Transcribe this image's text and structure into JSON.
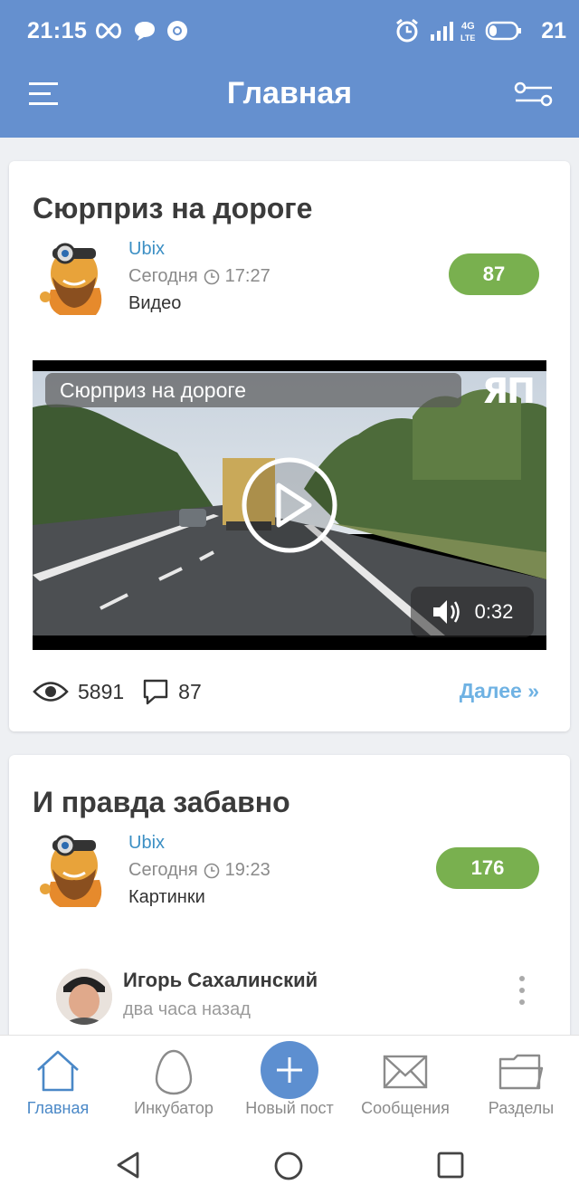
{
  "status_bar": {
    "time": "21:15",
    "battery": "21",
    "icons": [
      "infinity-icon",
      "chat-bubble-icon",
      "chrome-icon",
      "alarm-icon",
      "signal-icon",
      "4g-lte-icon",
      "battery-icon"
    ]
  },
  "header": {
    "title": "Главная",
    "menu_icon": "hamburger-menu-icon",
    "filter_icon": "filter-settings-icon"
  },
  "posts": [
    {
      "title": "Сюрприз на дороге",
      "author": "Ubix",
      "date": "Сегодня",
      "time": "17:27",
      "category": "Видео",
      "rating": "87",
      "video": {
        "title": "Сюрприз на дороге",
        "logo": "ЯП",
        "duration": "0:32"
      },
      "views": "5891",
      "comments": "87",
      "more_label": "Далее »"
    },
    {
      "title": "И правда забавно",
      "author": "Ubix",
      "date": "Сегодня",
      "time": "19:23",
      "category": "Картинки",
      "rating": "176",
      "embed": {
        "name": "Игорь Сахалинский",
        "time": "два часа назад"
      }
    }
  ],
  "tabs": [
    {
      "label": "Главная",
      "icon": "home-icon",
      "active": true
    },
    {
      "label": "Инкубатор",
      "icon": "egg-icon",
      "active": false
    },
    {
      "label": "Новый пост",
      "icon": "plus-icon",
      "active": false
    },
    {
      "label": "Сообщения",
      "icon": "envelope-icon",
      "active": false
    },
    {
      "label": "Разделы",
      "icon": "folder-icon",
      "active": false
    }
  ],
  "colors": {
    "header": "#6590cf",
    "rating": "#79b04f",
    "link": "#3c8fc4",
    "more_link": "#6fb2e3",
    "active_tab": "#4a88c7"
  }
}
